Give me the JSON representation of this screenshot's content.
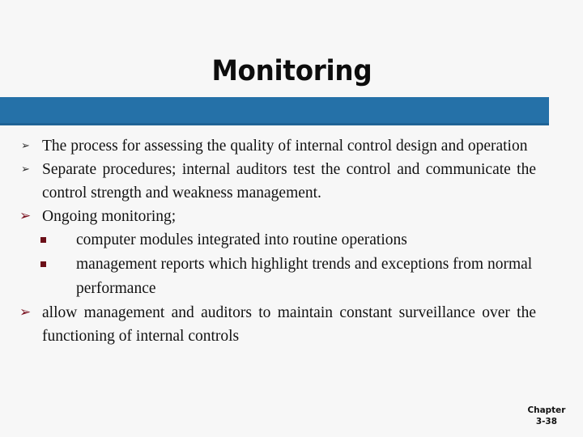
{
  "slide": {
    "title": "Monitoring",
    "accent_color": "#2571a8",
    "background_color": "#f7f7f7",
    "bullet_marker_glyph": "➢",
    "bullet_marker_color_primary": "#2e2e2e",
    "bullet_marker_color_accent": "#7a1220",
    "sub_marker_color": "#6b0f18"
  },
  "bullets": [
    {
      "id": "bullet-1",
      "level": 1,
      "marker": "➢",
      "marker_style": "arrow-sm",
      "text": "The process for assessing the quality of internal control design and operation"
    },
    {
      "id": "bullet-2",
      "level": 1,
      "marker": "➢",
      "marker_style": "arrow-sm",
      "text": "Separate procedures; internal auditors test the control and communicate the control strength and weakness management."
    },
    {
      "id": "bullet-3",
      "level": 1,
      "marker": "➢",
      "marker_style": "arrow-lg",
      "text": "Ongoing monitoring;"
    },
    {
      "id": "subbullet-1",
      "level": 2,
      "marker": "§",
      "text": "computer modules integrated into routine operations"
    },
    {
      "id": "subbullet-2",
      "level": 2,
      "marker": "§",
      "text": "management reports which highlight trends and exceptions from normal performance"
    },
    {
      "id": "bullet-4",
      "level": 1,
      "marker": "➢",
      "marker_style": "arrow-lg",
      "text": "allow management and auditors to maintain constant surveillance over the functioning of internal controls"
    }
  ],
  "footer": {
    "line1": "Chapter",
    "line2": "3-38"
  }
}
